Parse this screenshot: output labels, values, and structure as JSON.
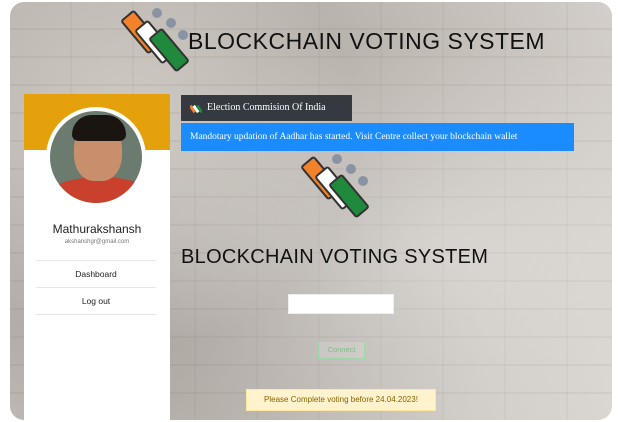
{
  "header": {
    "title": "BLOCKCHAIN VOTING SYSTEM"
  },
  "user": {
    "name": "Mathurakshansh",
    "email": "akshanshgr@gmail.com"
  },
  "menu": {
    "items": [
      "Dashboard",
      "Log out"
    ]
  },
  "tab": {
    "label": "Election Commision Of India"
  },
  "alert": {
    "text": "Mandotary updation of Aadhar has started. Visit Centre collect your blockchain wallet"
  },
  "main": {
    "title": "BLOCKCHAIN VOTING SYSTEM",
    "address_value": ""
  },
  "connect": {
    "label": "Connect"
  },
  "notice": {
    "text": "Please Complete voting before 24.04.2023!"
  },
  "colors": {
    "accent": "#e5a10b",
    "alert": "#1a8cff",
    "tab": "#343a40",
    "notice_bg": "#fff3cd"
  },
  "icons": [
    "election-commission-logo-icon",
    "election-commission-small-icon"
  ]
}
